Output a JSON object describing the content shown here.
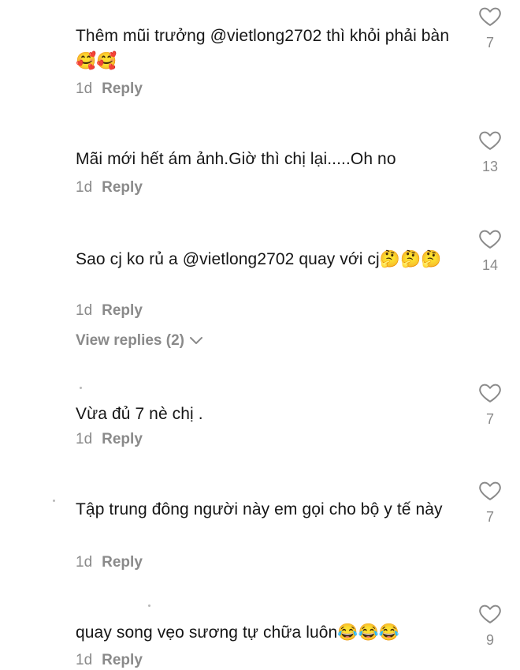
{
  "comments": [
    {
      "text": "Thêm mũi trưởng @vietlong2702 thì khỏi phải bàn🥰🥰",
      "time": "1d",
      "reply_label": "Reply",
      "likes": "7"
    },
    {
      "text": "Mãi mới hết ám ảnh.Giờ thì chị lại.....Oh no",
      "time": "1d",
      "reply_label": "Reply",
      "likes": "13"
    },
    {
      "text": "Sao cj ko rủ a @vietlong2702 quay với cj🤔🤔🤔",
      "time": "1d",
      "reply_label": "Reply",
      "likes": "14",
      "view_replies": "View replies (2)"
    },
    {
      "text": "Vừa đủ 7 nè chị .",
      "time": "1d",
      "reply_label": "Reply",
      "likes": "7"
    },
    {
      "text": "Tập trung đông người này em gọi cho bộ y tế này",
      "time": "1d",
      "reply_label": "Reply",
      "likes": "7"
    },
    {
      "text": "quay song vẹo sương tự chữa luôn😂😂😂",
      "time": "1d",
      "reply_label": "Reply",
      "likes": "9"
    }
  ],
  "icons": {
    "like": "heart-outline-icon",
    "expand": "chevron-down-icon"
  },
  "colors": {
    "text": "#161616",
    "muted": "#8a8a8a",
    "background": "#ffffff"
  }
}
